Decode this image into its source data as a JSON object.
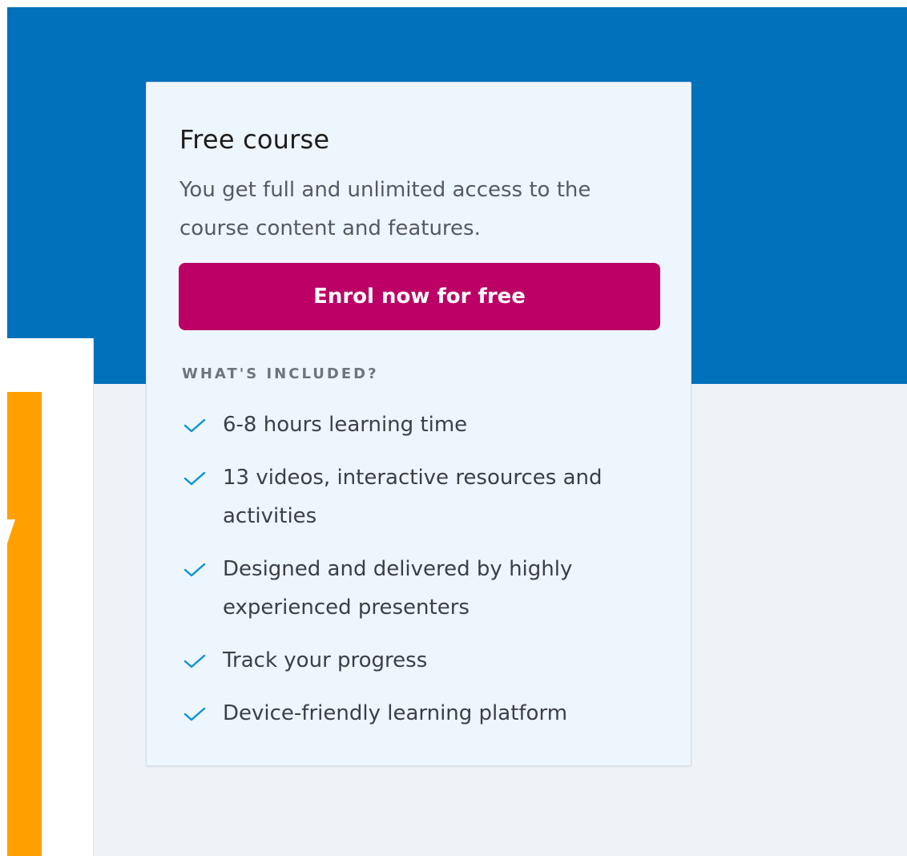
{
  "card": {
    "title": "Free course",
    "description": "You get full and unlimited access to the course content and features.",
    "enrol_label": "Enrol now for free",
    "included_heading": "WHAT'S INCLUDED?",
    "features": [
      "6-8 hours learning time",
      "13 videos, interactive resources and activities",
      "Designed and delivered by highly experienced presenters",
      "Track your progress",
      "Device-friendly learning platform"
    ]
  },
  "icons": {
    "feature_check": "check-icon"
  },
  "colors": {
    "hero_blue": "#0071bb",
    "card_bg": "#eef6fd",
    "enrol_button": "#bc0066",
    "check": "#0a93d8",
    "accent_orange": "#ffa000",
    "lower_bg": "#eef3f8"
  }
}
